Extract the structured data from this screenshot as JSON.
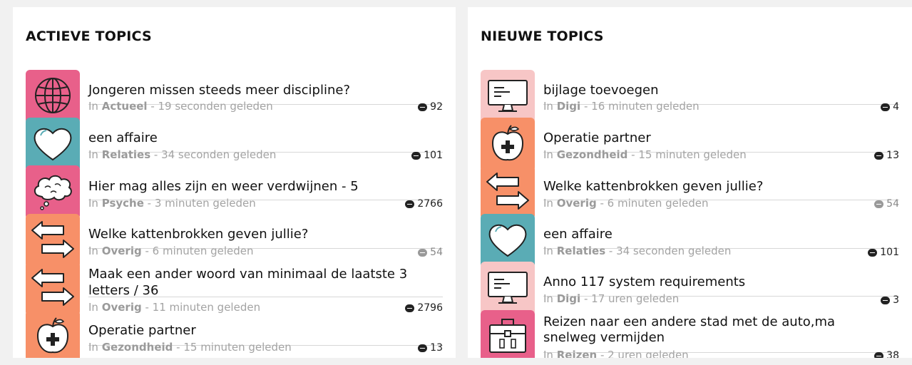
{
  "left_panel": {
    "title": "ACTIEVE TOPICS",
    "topics": [
      {
        "title_lines": [
          "Jongeren missen steeds meer discipline?"
        ],
        "in": "In",
        "category": "Actueel",
        "time": " - 19 seconden geleden",
        "count": "92",
        "icon": "globe-icon",
        "icon_color": "#e8608a"
      },
      {
        "title_lines": [
          "een affaire"
        ],
        "in": "In",
        "category": "Relaties",
        "time": " - 34 seconden geleden",
        "count": "101",
        "icon": "heart-icon",
        "icon_color": "#5aacb5"
      },
      {
        "title_lines": [
          "Hier mag alles zijn en weer verdwijnen - 5"
        ],
        "in": "In",
        "category": "Psyche",
        "time": " - 3 minuten geleden",
        "count": "2766",
        "icon": "thought-cloud-icon",
        "icon_color": "#e8608a"
      },
      {
        "title_lines": [
          "Welke kattenbrokken geven jullie?"
        ],
        "in": "In",
        "category": "Overig",
        "time": " - 6 minuten geleden",
        "count": "54",
        "icon": "swap-arrows-icon",
        "icon_color": "#f79068"
      },
      {
        "title_lines": [
          "Maak een ander woord van minimaal de laatste 3",
          "letters / 36"
        ],
        "in": "In",
        "category": "Overig",
        "time": " - 11 minuten geleden",
        "count": "2796",
        "icon": "swap-arrows-icon",
        "icon_color": "#f79068"
      },
      {
        "title_lines": [
          "Operatie partner"
        ],
        "in": "In",
        "category": "Gezondheid",
        "time": " - 15 minuten geleden",
        "count": "13",
        "icon": "apple-cross-icon",
        "icon_color": "#f79068"
      }
    ]
  },
  "right_panel": {
    "title": "NIEUWE TOPICS",
    "topics": [
      {
        "title_lines": [
          "bijlage toevoegen"
        ],
        "in": "In",
        "category": "Digi",
        "time": " - 16 minuten geleden",
        "count": "4",
        "icon": "monitor-icon",
        "icon_color": "#f7c6c6"
      },
      {
        "title_lines": [
          "Operatie partner"
        ],
        "in": "In",
        "category": "Gezondheid",
        "time": " - 15 minuten geleden",
        "count": "13",
        "icon": "apple-cross-icon",
        "icon_color": "#f79068"
      },
      {
        "title_lines": [
          "Welke kattenbrokken geven jullie?"
        ],
        "in": "In",
        "category": "Overig",
        "time": " - 6 minuten geleden",
        "count": "54",
        "icon": "swap-arrows-icon",
        "icon_color": "#f79068"
      },
      {
        "title_lines": [
          "een affaire"
        ],
        "in": "In",
        "category": "Relaties",
        "time": " - 34 seconden geleden",
        "count": "101",
        "icon": "heart-icon",
        "icon_color": "#5aacb5"
      },
      {
        "title_lines": [
          "Anno 117 system requirements"
        ],
        "in": "In",
        "category": "Digi",
        "time": " - 17 uren geleden",
        "count": "3",
        "icon": "monitor-icon",
        "icon_color": "#f7c6c6"
      },
      {
        "title_lines": [
          "Reizen naar een andere stad met de auto,ma",
          "snelweg vermijden"
        ],
        "in": "In",
        "category": "Reizen",
        "time": " - 2 uren geleden",
        "count": "38",
        "icon": "suitcase-icon",
        "icon_color": "#e8608a"
      }
    ]
  }
}
